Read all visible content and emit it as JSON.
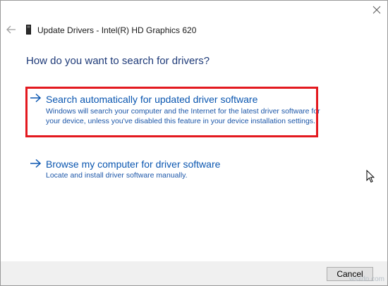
{
  "window": {
    "title": "Update Drivers - Intel(R) HD Graphics 620"
  },
  "heading": "How do you want to search for drivers?",
  "options": [
    {
      "title": "Search automatically for updated driver software",
      "description": "Windows will search your computer and the Internet for the latest driver software for your device, unless you've disabled this feature in your device installation settings."
    },
    {
      "title": "Browse my computer for driver software",
      "description": "Locate and install driver software manually."
    }
  ],
  "footer": {
    "cancel_label": "Cancel"
  },
  "watermark": "wsxdn.com",
  "colors": {
    "link_blue": "#0a56b0",
    "heading_blue": "#1e3a78",
    "highlight_red": "#e3191f"
  }
}
